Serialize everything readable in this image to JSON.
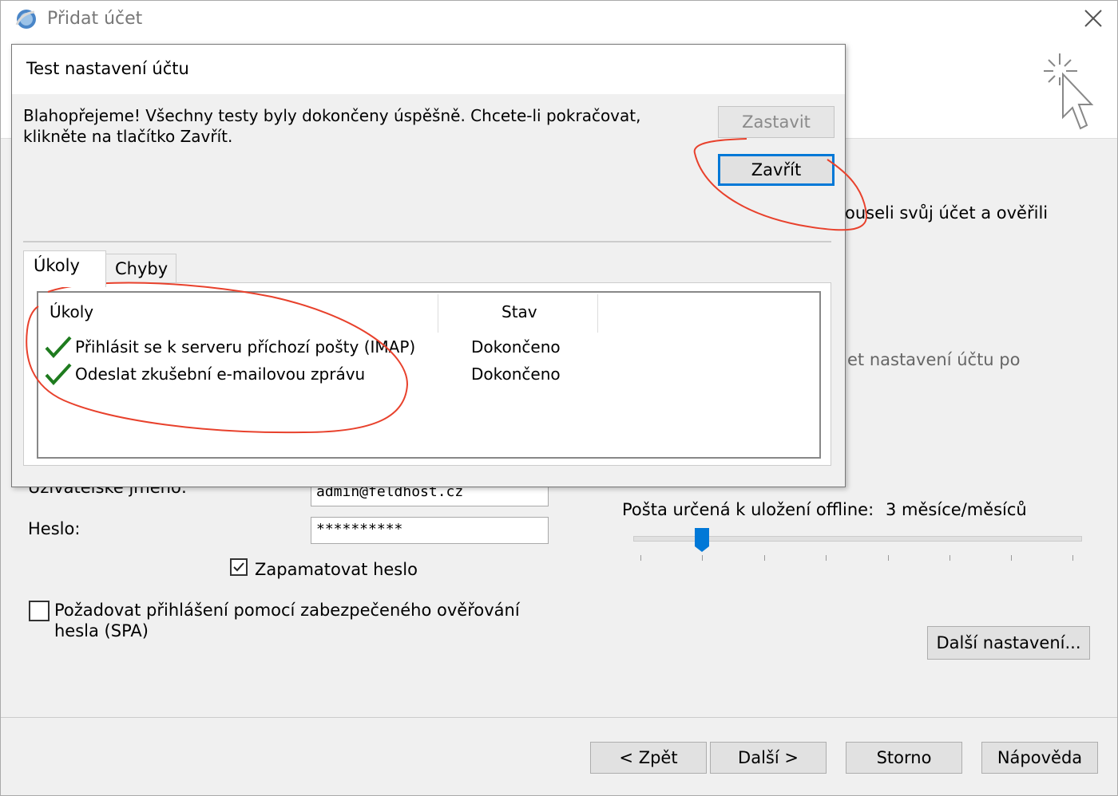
{
  "window": {
    "title": "Přidat účet"
  },
  "background": {
    "partial_text_1": "ouseli svůj účet a ověřili",
    "partial_text_2": "et nastavení účtu po",
    "username_label": "Uživatelské jméno:",
    "username_value": "admin@feldhost.cz",
    "password_label": "Heslo:",
    "password_value": "**********",
    "remember_label": "Zapamatovat heslo",
    "remember_checked": true,
    "spa_label_line1": "Požadovat přihlášení pomocí zabezpečeného ověřování",
    "spa_label_line2": "hesla (SPA)",
    "spa_checked": false,
    "offline_label": "Pošta určená k uložení offline:",
    "offline_value": "3 měsíce/měsíců",
    "offline_slider_position": 0.14,
    "more_settings_label": "Další nastavení..."
  },
  "footer": {
    "back_label": "< Zpět",
    "next_label": "Další >",
    "cancel_label": "Storno",
    "help_label": "Nápověda"
  },
  "dialog": {
    "title": "Test nastavení účtu",
    "message_line1": "Blahopřejeme! Všechny testy byly dokončeny úspěšně. Chcete-li pokračovat,",
    "message_line2": "klikněte na tlačítko Zavřít.",
    "stop_label": "Zastavit",
    "close_label": "Zavřít",
    "tabs": [
      {
        "label": "Úkoly",
        "active": true
      },
      {
        "label": "Chyby",
        "active": false
      }
    ],
    "columns": {
      "task": "Úkoly",
      "status": "Stav"
    },
    "rows": [
      {
        "task": "Přihlásit se k serveru příchozí pošty (IMAP)",
        "status": "Dokončeno",
        "icon": "checkmark-icon"
      },
      {
        "task": "Odeslat zkušební e-mailovou zprávu",
        "status": "Dokončeno",
        "icon": "checkmark-icon"
      }
    ]
  },
  "colors": {
    "annotation": "#e8412c",
    "check_green": "#1e7b1e",
    "focus_border": "#0078d7",
    "slider_thumb": "#0078d7"
  }
}
